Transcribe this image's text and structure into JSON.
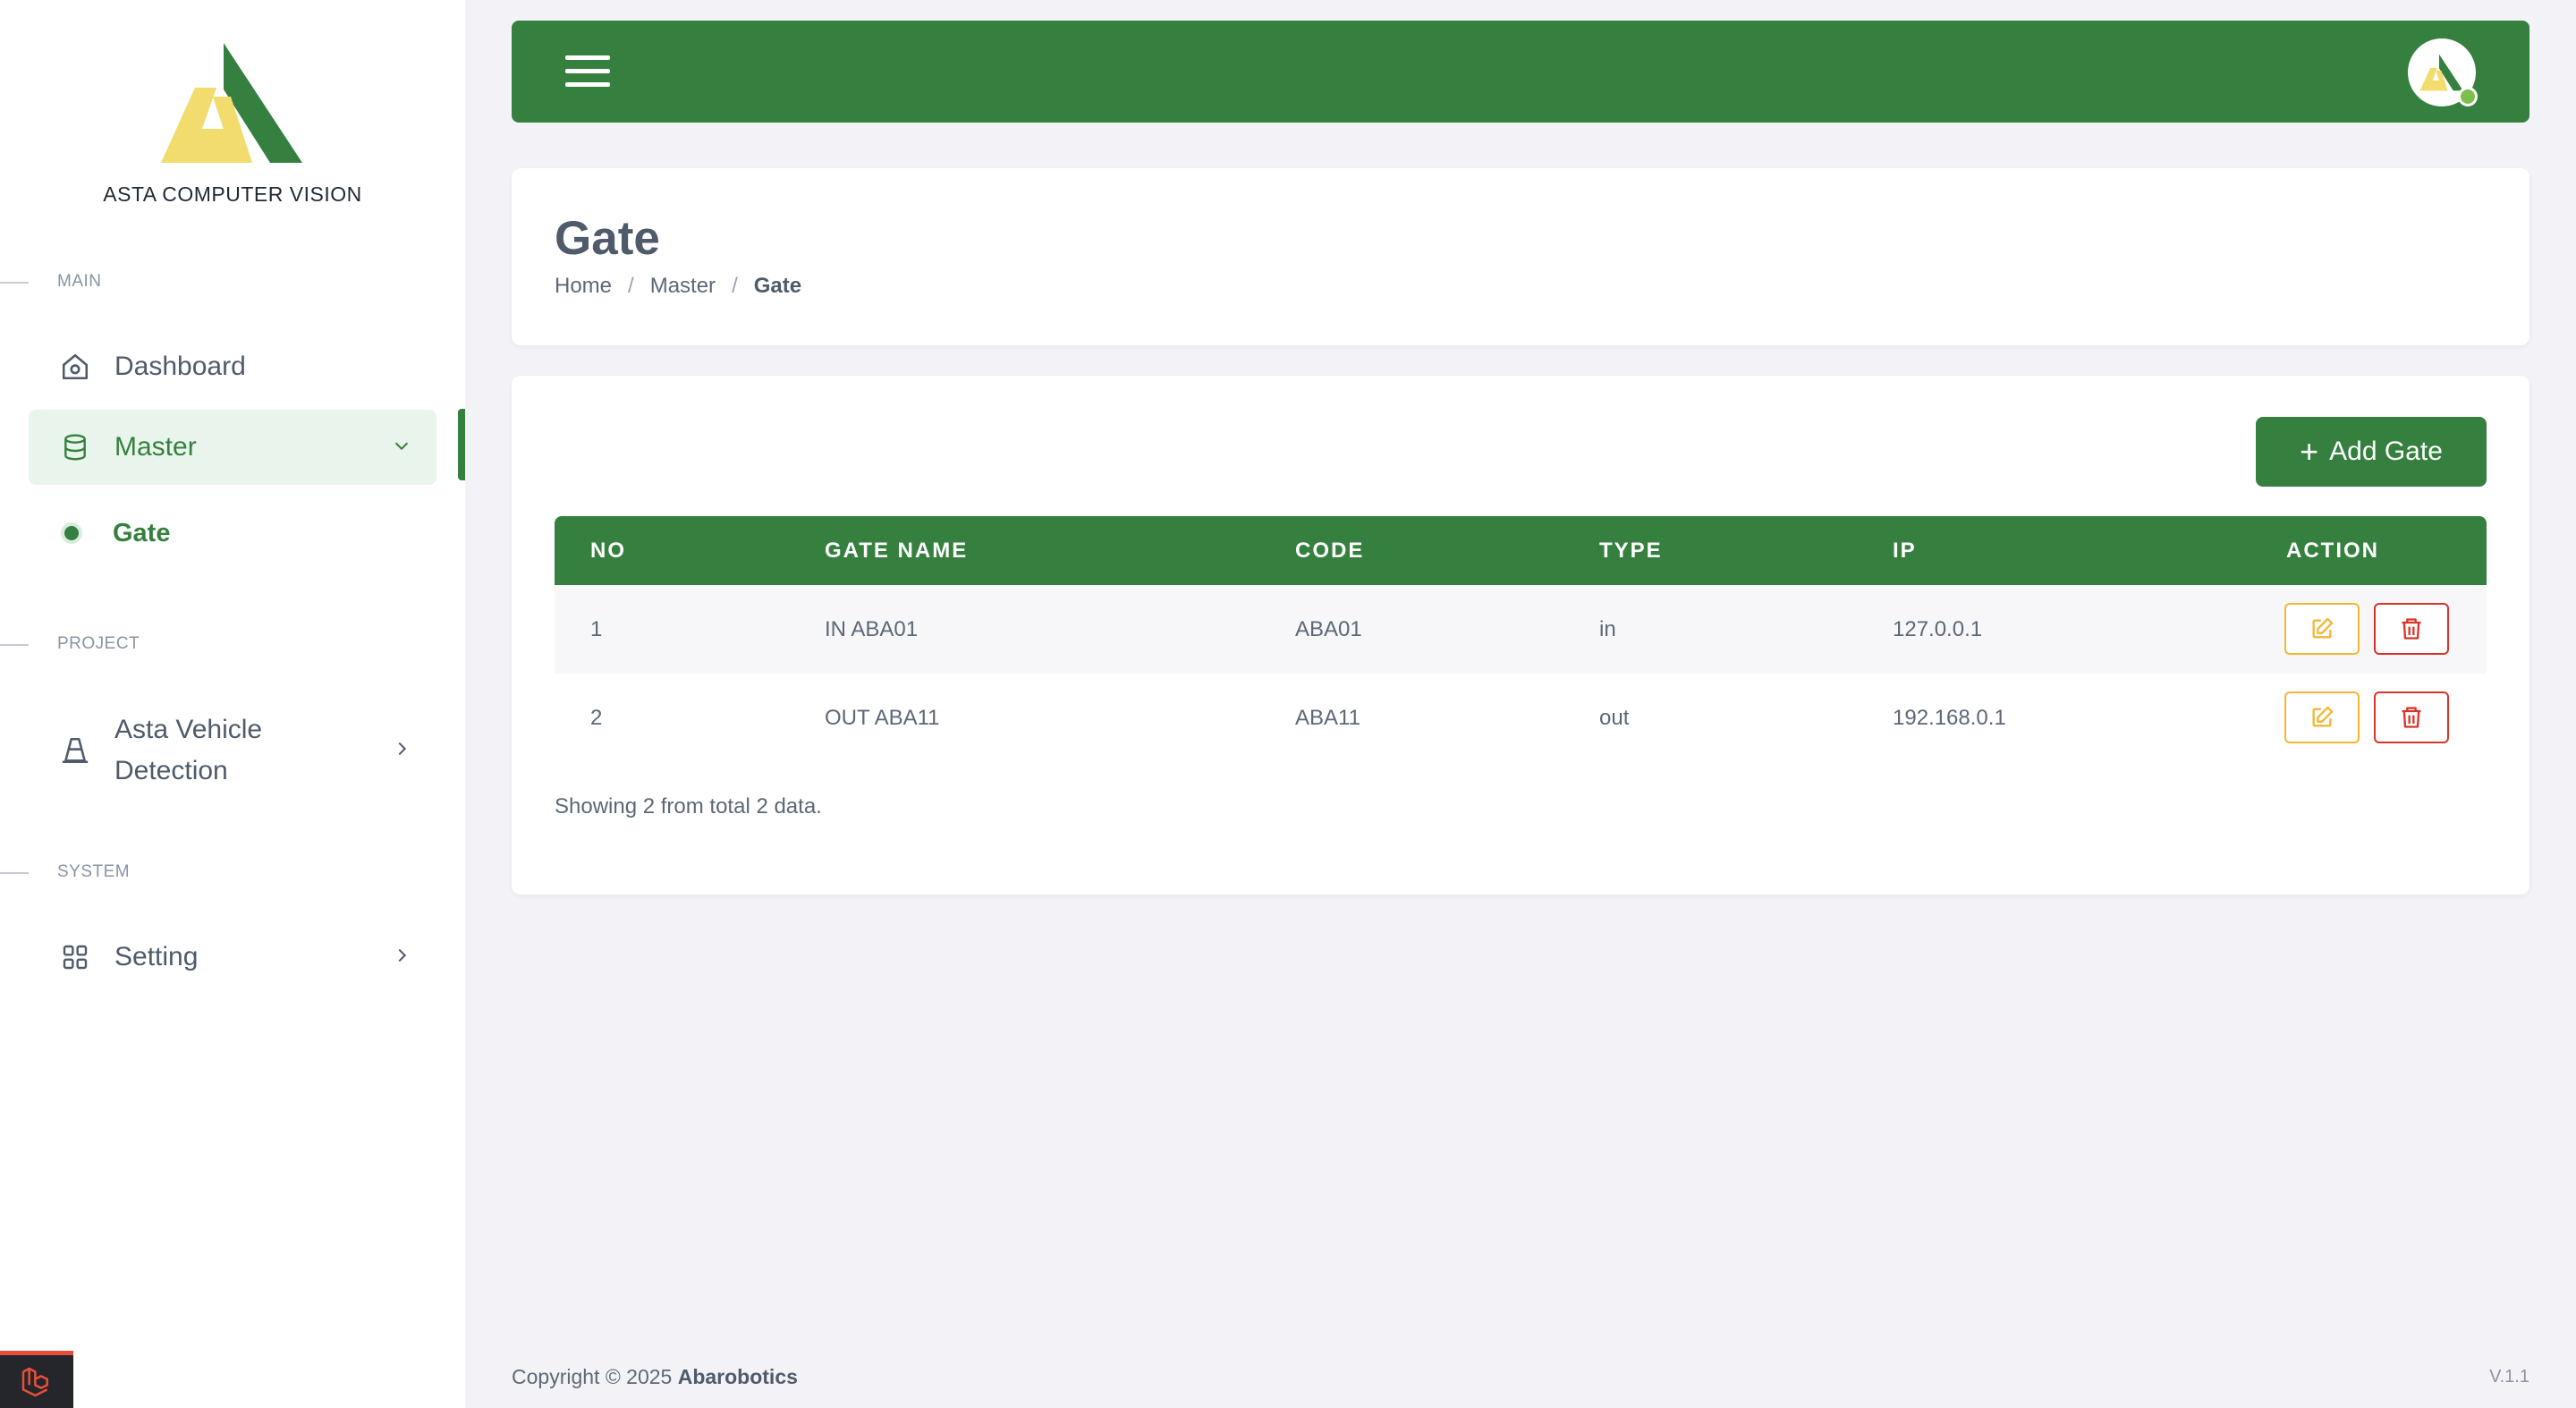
{
  "brand": {
    "name": "ASTA COMPUTER VISION",
    "colors": {
      "green": "#36803f",
      "yellow": "#f2dc6e"
    }
  },
  "sidebar": {
    "sections": [
      {
        "label": "MAIN"
      },
      {
        "label": "PROJECT"
      },
      {
        "label": "SYSTEM"
      }
    ],
    "items": [
      {
        "label": "Dashboard",
        "icon": "home-icon"
      },
      {
        "label": "Master",
        "icon": "database-icon",
        "expanded": true
      },
      {
        "label": "Gate",
        "icon": "dot-icon",
        "active": true
      },
      {
        "label_line1": "Asta Vehicle",
        "label_line2": "Detection",
        "icon": "traffic-cone-icon"
      },
      {
        "label": "Setting",
        "icon": "grid-icon"
      }
    ]
  },
  "header": {
    "title": "Gate",
    "breadcrumb": [
      "Home",
      "Master",
      "Gate"
    ]
  },
  "table": {
    "add_button": "Add Gate",
    "columns": [
      "NO",
      "GATE NAME",
      "CODE",
      "TYPE",
      "IP",
      "ACTION"
    ],
    "rows": [
      {
        "no": "1",
        "gate_name": "IN ABA01",
        "code": "ABA01",
        "type": "in",
        "ip": "127.0.0.1"
      },
      {
        "no": "2",
        "gate_name": "OUT ABA11",
        "code": "ABA11",
        "type": "out",
        "ip": "192.168.0.1"
      }
    ],
    "summary": "Showing 2 from total 2 data."
  },
  "footer": {
    "copyright_prefix": "Copyright © 2025 ",
    "company": "Abarobotics",
    "version": "V.1.1"
  }
}
